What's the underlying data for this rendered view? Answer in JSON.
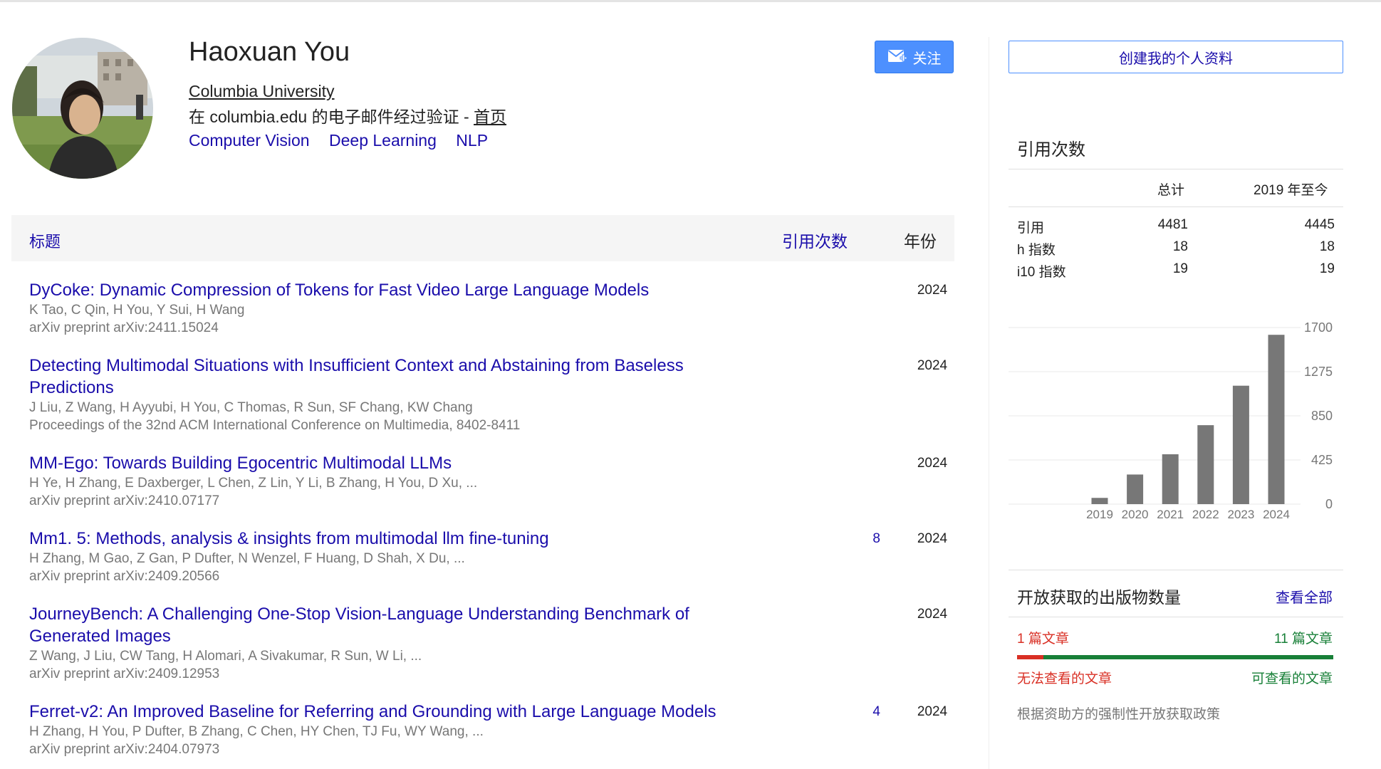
{
  "profile": {
    "name": "Haoxuan You",
    "affiliation": "Columbia University",
    "verified_prefix": "在 columbia.edu 的电子邮件经过验证 - ",
    "homepage_label": "首页",
    "interests": [
      "Computer Vision",
      "Deep Learning",
      "NLP"
    ],
    "follow_label": "关注"
  },
  "table": {
    "col_title": "标题",
    "col_cited": "引用次数",
    "col_year": "年份",
    "rows": [
      {
        "title": "DyCoke: Dynamic Compression of Tokens for Fast Video Large Language Models",
        "authors": "K Tao, C Qin, H You, Y Sui, H Wang",
        "venue": "arXiv preprint arXiv:2411.15024",
        "cites": "",
        "year": "2024"
      },
      {
        "title": "Detecting Multimodal Situations with Insufficient Context and Abstaining from Baseless Predictions",
        "authors": "J Liu, Z Wang, H Ayyubi, H You, C Thomas, R Sun, SF Chang, KW Chang",
        "venue": "Proceedings of the 32nd ACM International Conference on Multimedia, 8402-8411",
        "cites": "",
        "year": "2024"
      },
      {
        "title": "MM-Ego: Towards Building Egocentric Multimodal LLMs",
        "authors": "H Ye, H Zhang, E Daxberger, L Chen, Z Lin, Y Li, B Zhang, H You, D Xu, ...",
        "venue": "arXiv preprint arXiv:2410.07177",
        "cites": "",
        "year": "2024"
      },
      {
        "title": "Mm1. 5: Methods, analysis & insights from multimodal llm fine-tuning",
        "authors": "H Zhang, M Gao, Z Gan, P Dufter, N Wenzel, F Huang, D Shah, X Du, ...",
        "venue": "arXiv preprint arXiv:2409.20566",
        "cites": "8",
        "year": "2024"
      },
      {
        "title": "JourneyBench: A Challenging One-Stop Vision-Language Understanding Benchmark of Generated Images",
        "authors": "Z Wang, J Liu, CW Tang, H Alomari, A Sivakumar, R Sun, W Li, ...",
        "venue": "arXiv preprint arXiv:2409.12953",
        "cites": "",
        "year": "2024"
      },
      {
        "title": "Ferret-v2: An Improved Baseline for Referring and Grounding with Large Language Models",
        "authors": "H Zhang, H You, P Dufter, B Zhang, C Chen, HY Chen, TJ Fu, WY Wang, ...",
        "venue": "arXiv preprint arXiv:2404.07973",
        "cites": "4",
        "year": "2024"
      }
    ]
  },
  "sidebar": {
    "create_profile_label": "创建我的个人资料",
    "cited_heading": "引用次数",
    "stats_head_total": "总计",
    "stats_head_recent": "2019 年至今",
    "stats": [
      {
        "label": "引用",
        "total": "4481",
        "recent": "4445"
      },
      {
        "label": "h 指数",
        "total": "18",
        "recent": "18"
      },
      {
        "label": "i10 指数",
        "total": "19",
        "recent": "19"
      }
    ],
    "open_access": {
      "heading": "开放获取的出版物数量",
      "view_all": "查看全部",
      "unavailable_count": "1 篇文章",
      "available_count": "11 篇文章",
      "unavailable_label": "无法查看的文章",
      "available_label": "可查看的文章",
      "unavailable_fraction": 0.0833,
      "policy_note": "根据资助方的强制性开放获取政策",
      "color_unavailable": "#d93025",
      "color_available": "#188038"
    }
  },
  "chart_data": {
    "type": "bar",
    "categories": [
      "2019",
      "2020",
      "2021",
      "2022",
      "2023",
      "2024"
    ],
    "values": [
      60,
      285,
      480,
      760,
      1140,
      1630
    ],
    "yticks": [
      "1700",
      "1275",
      "850",
      "425",
      "0"
    ],
    "ylim": [
      0,
      1700
    ],
    "grid": true,
    "bar_color": "#777777"
  }
}
